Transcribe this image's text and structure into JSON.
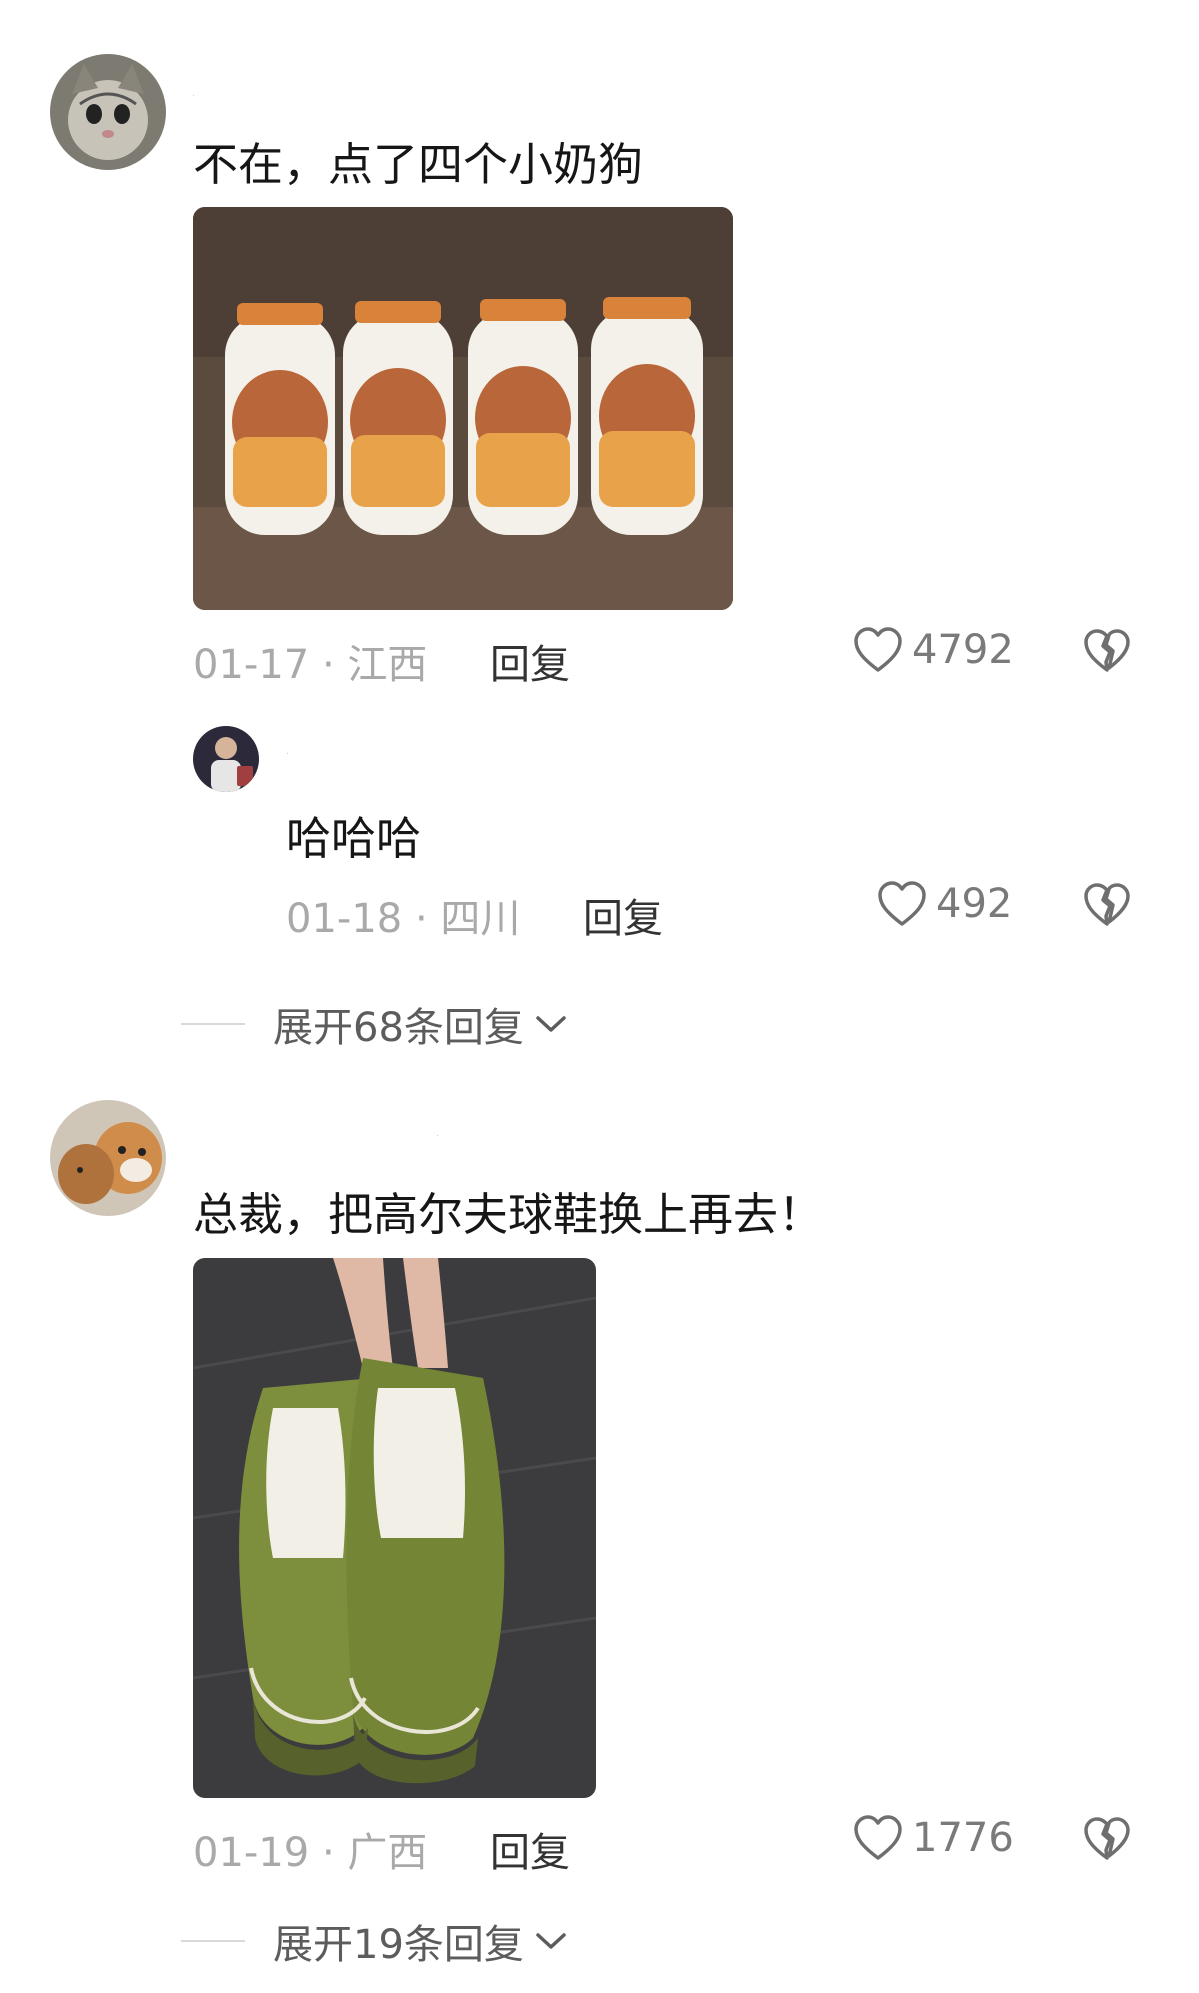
{
  "comments": [
    {
      "text": "不在，点了四个小奶狗",
      "date": "01-17",
      "separator": "·",
      "region": "江西",
      "reply_label": "回复",
      "likes": "4792",
      "avatar": "cat-avatar",
      "replies": [
        {
          "text": "哈哈哈",
          "date": "01-18",
          "separator": "·",
          "region": "四川",
          "reply_label": "回复",
          "likes": "492",
          "avatar": "person-avatar"
        }
      ],
      "expand_label": "展开68条回复"
    },
    {
      "text": "总裁，把高尔夫球鞋换上再去！",
      "date": "01-19",
      "separator": "·",
      "region": "广西",
      "reply_label": "回复",
      "likes": "1776",
      "avatar": "dog-avatar",
      "expand_label": "展开19条回复"
    }
  ],
  "icons": {
    "like": "heart-outline-icon",
    "dislike": "broken-heart-icon",
    "expand": "chevron-down-icon"
  },
  "colors": {
    "meta": "#a9a9a9",
    "text": "#161616",
    "bottles": "#e8a24a",
    "shoes": "#7d8f3c"
  }
}
